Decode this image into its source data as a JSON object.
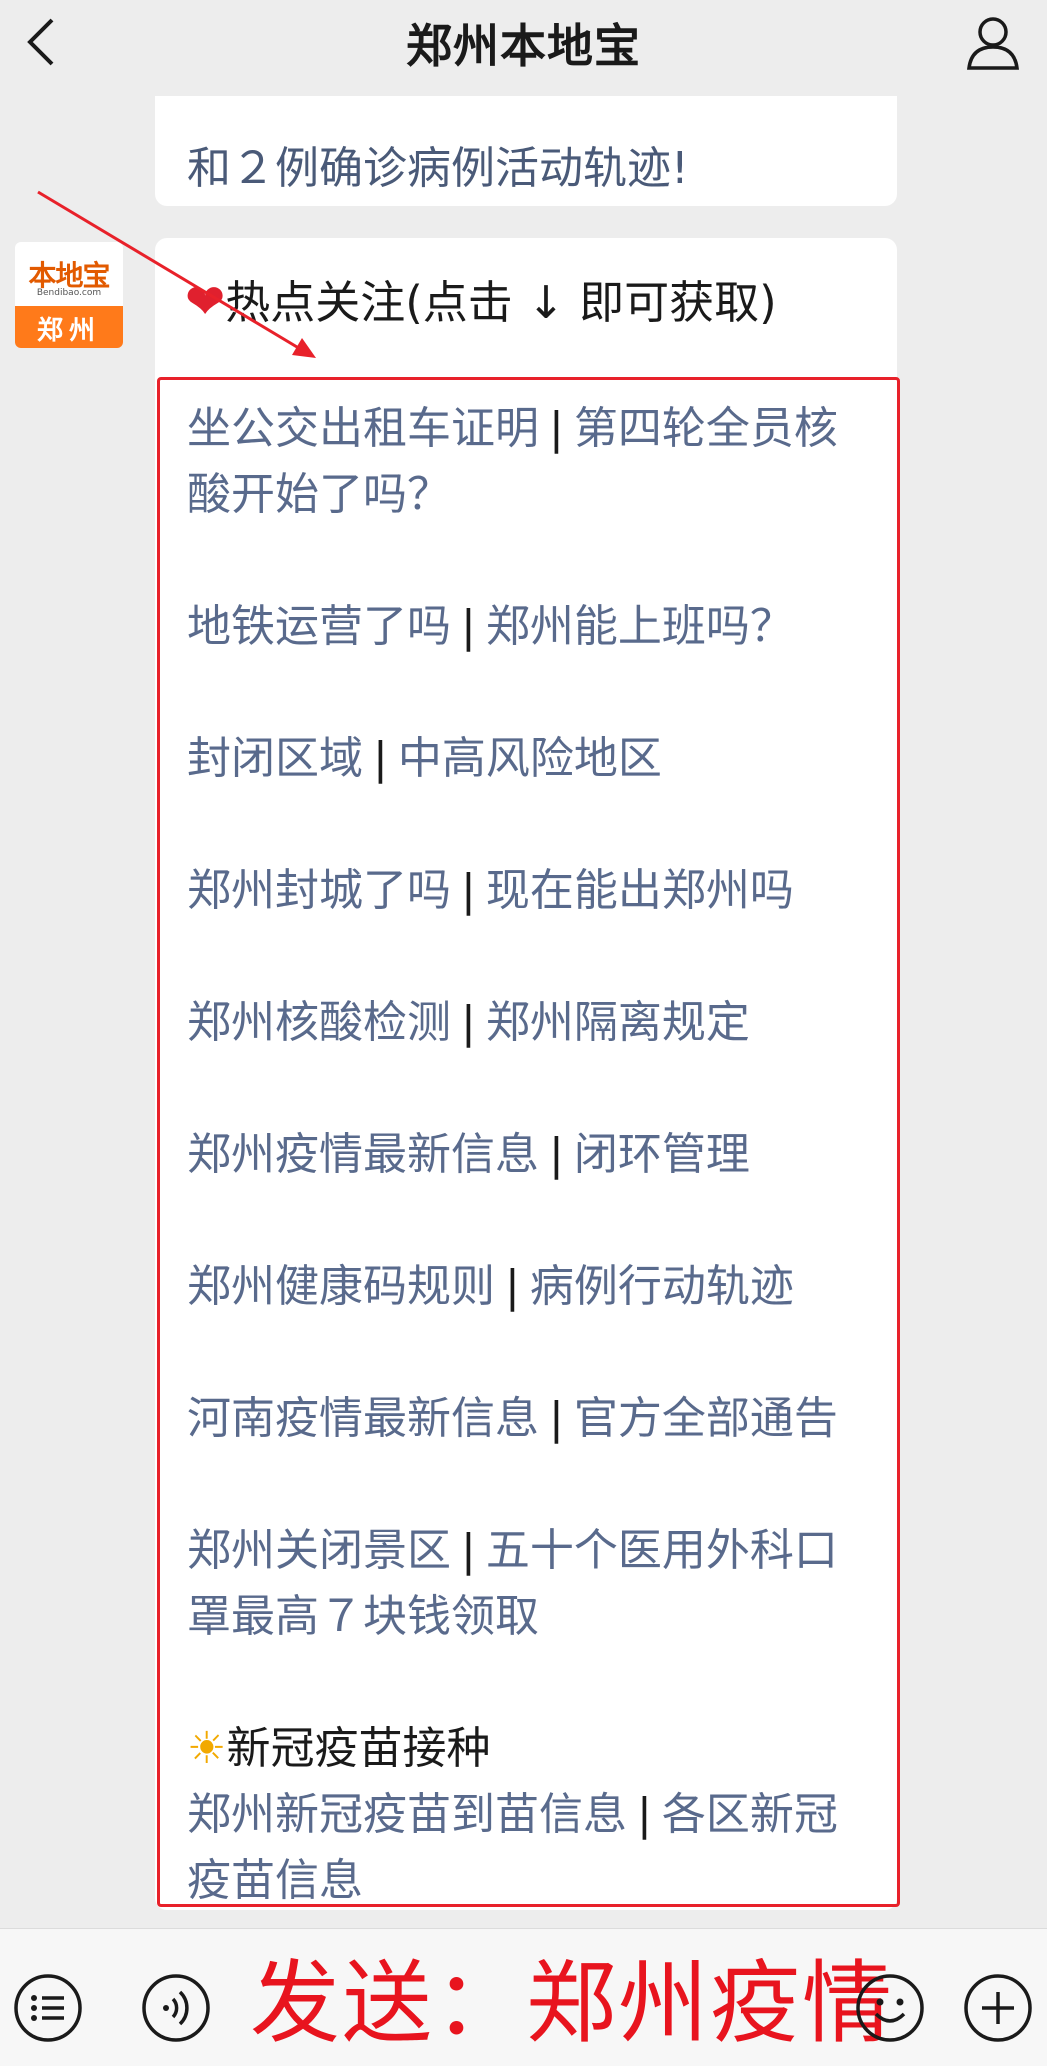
{
  "topbar": {
    "title": "郑州本地宝",
    "back_icon": "chevron-left-icon",
    "profile_icon": "user-icon"
  },
  "previous_message": {
    "text": "和２例确诊病例活动轨迹!"
  },
  "avatar": {
    "brand": "本地宝",
    "domain": "Bendibao.com",
    "city": "郑州",
    "colors": {
      "top": "#ffffff",
      "bottom": "#ff7a1a"
    }
  },
  "hot": {
    "title": "热点关注(点击 ↓ 即可获取)"
  },
  "links": [
    {
      "left": "坐公交出租车证明",
      "right": "第四轮全员核酸开始了吗？"
    },
    {
      "left": "地铁运营了吗",
      "right": "郑州能上班吗？"
    },
    {
      "left": "封闭区域",
      "right": "中高风险地区"
    },
    {
      "left": "郑州封城了吗",
      "right": "现在能出郑州吗"
    },
    {
      "left": "郑州核酸检测",
      "right": "郑州隔离规定"
    },
    {
      "left": "郑州疫情最新信息",
      "right": "闭环管理"
    },
    {
      "left": "郑州健康码规则",
      "right": "病例行动轨迹"
    },
    {
      "left": "河南疫情最新信息",
      "right": "官方全部通告"
    },
    {
      "left": "郑州关闭景区",
      "right": "五十个医用外科口罩最高７块钱领取"
    }
  ],
  "vaccine": {
    "title": "新冠疫苗接种",
    "left": "郑州新冠疫苗到苗信息",
    "right": "各区新冠疫苗信息"
  },
  "separator": "|",
  "bottom": {
    "send_text": "发送：郑州疫情",
    "icons": [
      "menu-list-icon",
      "voice-icon",
      "emoji-icon",
      "plus-icon"
    ]
  },
  "colors": {
    "link": "#596a8c",
    "highlight_border": "#e8212a",
    "send_text": "#e8141e"
  }
}
